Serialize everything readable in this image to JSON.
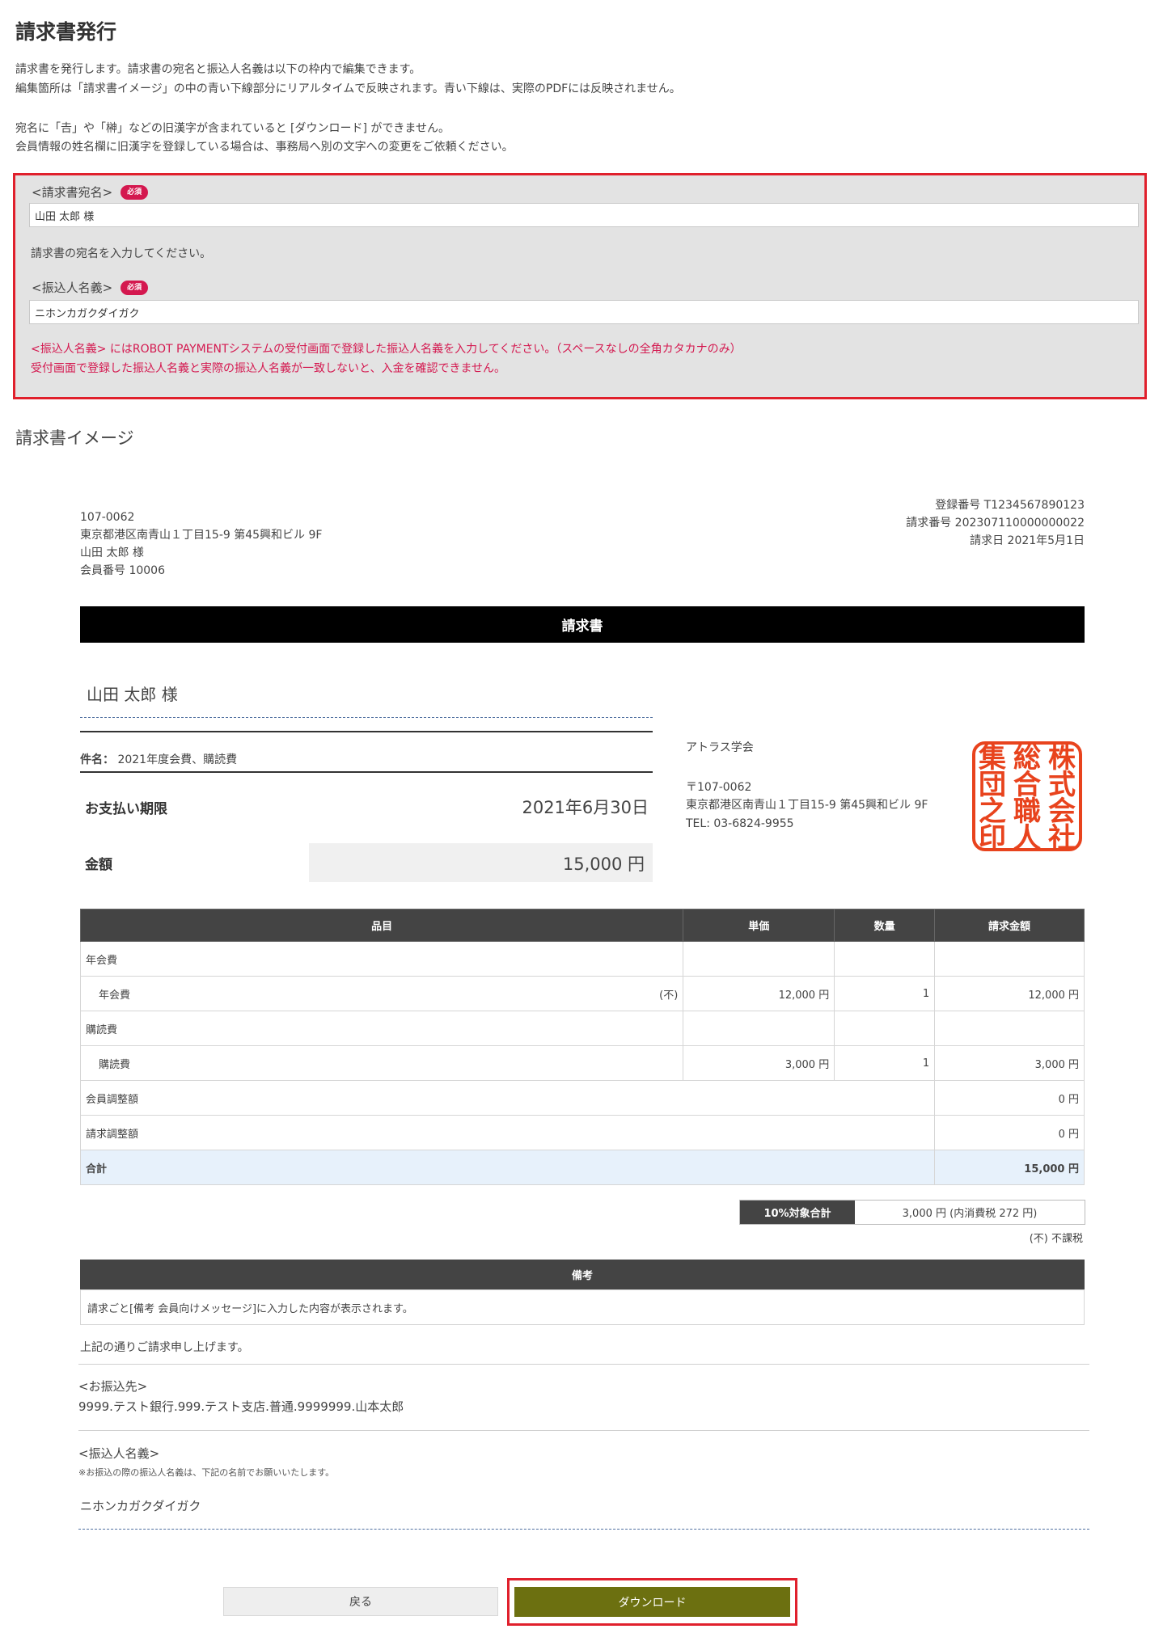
{
  "page_title": "請求書発行",
  "intro": {
    "line1": "請求書を発行します。請求書の宛名と振込人名義は以下の枠内で編集できます。",
    "line2": "編集箇所は「請求書イメージ」の中の青い下線部分にリアルタイムで反映されます。青い下線は、実際のPDFには反映されません。",
    "line3": "宛名に「𠮷」や「榊」などの旧漢字が含まれていると [ダウンロード] ができません。",
    "line4": "会員情報の姓名欄に旧漢字を登録している場合は、事務局へ別の文字への変更をご依頼ください。"
  },
  "form": {
    "addressee_label": "<請求書宛名>",
    "required_badge": "必須",
    "addressee_value": "山田 太郎 様",
    "addressee_help": "請求書の宛名を入力してください。",
    "payer_label": "<振込人名義>",
    "payer_value": "ニホンカガクダイガク",
    "payer_note1": "<振込人名義> にはROBOT PAYMENTシステムの受付画面で登録した振込人名義を入力してください。（スペースなしの全角カタカナのみ）",
    "payer_note2": "受付画面で登録した振込人名義と実際の振込人名義が一致しないと、入金を確認できません。"
  },
  "preview_heading": "請求書イメージ",
  "invoice": {
    "recipient": {
      "postal": "107-0062",
      "address": "東京都港区南青山１丁目15-9 第45興和ビル 9F",
      "name": "山田 太郎 様",
      "member_no": "会員番号 10006"
    },
    "meta": {
      "registration": "登録番号 T1234567890123",
      "invoice_no": "請求番号 202307110000000022",
      "date": "請求日 2021年5月1日"
    },
    "title": "請求書",
    "addressee": "山田 太郎 様",
    "subject_label": "件名：",
    "subject": "2021年度会費、購読費",
    "due_label": "お支払い期限",
    "due_value": "2021年6月30日",
    "amount_label": "金額",
    "amount_value": "15,000 円",
    "issuer": {
      "name": "アトラス学会",
      "postal": "〒107-0062",
      "address": "東京都港区南青山１丁目15-9 第45興和ビル 9F",
      "tel": "TEL: 03-6824-9955"
    },
    "seal_chars": [
      "株",
      "総",
      "集",
      "式",
      "合",
      "団",
      "会",
      "職",
      "之",
      "社",
      "人",
      "印"
    ],
    "seal_color": "#e8431d",
    "table": {
      "headers": [
        "品目",
        "単価",
        "数量",
        "請求金額"
      ],
      "rows": [
        {
          "item": "年会費",
          "note": "",
          "price": "",
          "qty": "",
          "amount": "",
          "type": "group"
        },
        {
          "item": "年会費",
          "note": "(不)",
          "price": "12,000 円",
          "qty": "1",
          "amount": "12,000 円",
          "type": "detail"
        },
        {
          "item": "購読費",
          "note": "",
          "price": "",
          "qty": "",
          "amount": "",
          "type": "group"
        },
        {
          "item": "購読費",
          "note": "",
          "price": "3,000 円",
          "qty": "1",
          "amount": "3,000 円",
          "type": "detail"
        },
        {
          "item": "会員調整額",
          "amount": "0 円",
          "type": "adjust"
        },
        {
          "item": "請求調整額",
          "amount": "0 円",
          "type": "adjust"
        },
        {
          "item": "合計",
          "amount": "15,000 円",
          "type": "total"
        }
      ]
    },
    "tax_label": "10%対象合計",
    "tax_value": "3,000 円 (内消費税 272 円)",
    "tax_note": "(不) 不課税",
    "remarks_label": "備考",
    "remarks_text": "請求ごと[備考 会員向けメッセージ]に入力した内容が表示されます。",
    "closing": "上記の通りご請求申し上げます。",
    "bank_label": "<お振込先>",
    "bank_value": "9999.テスト銀行.999.テスト支店.普通.9999999.山本太郎",
    "payer_label": "<振込人名義>",
    "payer_note": "※お振込の際の振込人名義は、下記の名前でお願いいたします。",
    "payer_value": "ニホンカガクダイガク"
  },
  "buttons": {
    "back": "戻る",
    "download": "ダウンロード"
  }
}
